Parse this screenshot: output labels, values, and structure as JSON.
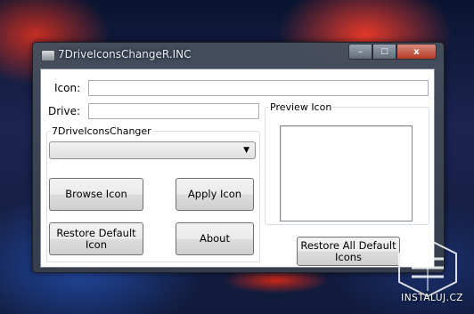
{
  "window": {
    "title": "7DriveIconsChangeR.INC",
    "controls": {
      "minimize": "–",
      "maximize": "□",
      "close": "x"
    }
  },
  "form": {
    "icon_label": "Icon:",
    "icon_value": "",
    "drive_label": "Drive:",
    "drive_value": ""
  },
  "group_main": {
    "legend": "7DriveIconsChanger",
    "combo_value": "",
    "buttons": {
      "browse": "Browse Icon",
      "apply": "Apply Icon",
      "restore_default": "Restore Default Icon",
      "about": "About"
    }
  },
  "group_preview": {
    "legend": "Preview Icon",
    "restore_all": "Restore All Default Icons"
  },
  "watermark": {
    "text": "INSTALUJ.CZ"
  }
}
